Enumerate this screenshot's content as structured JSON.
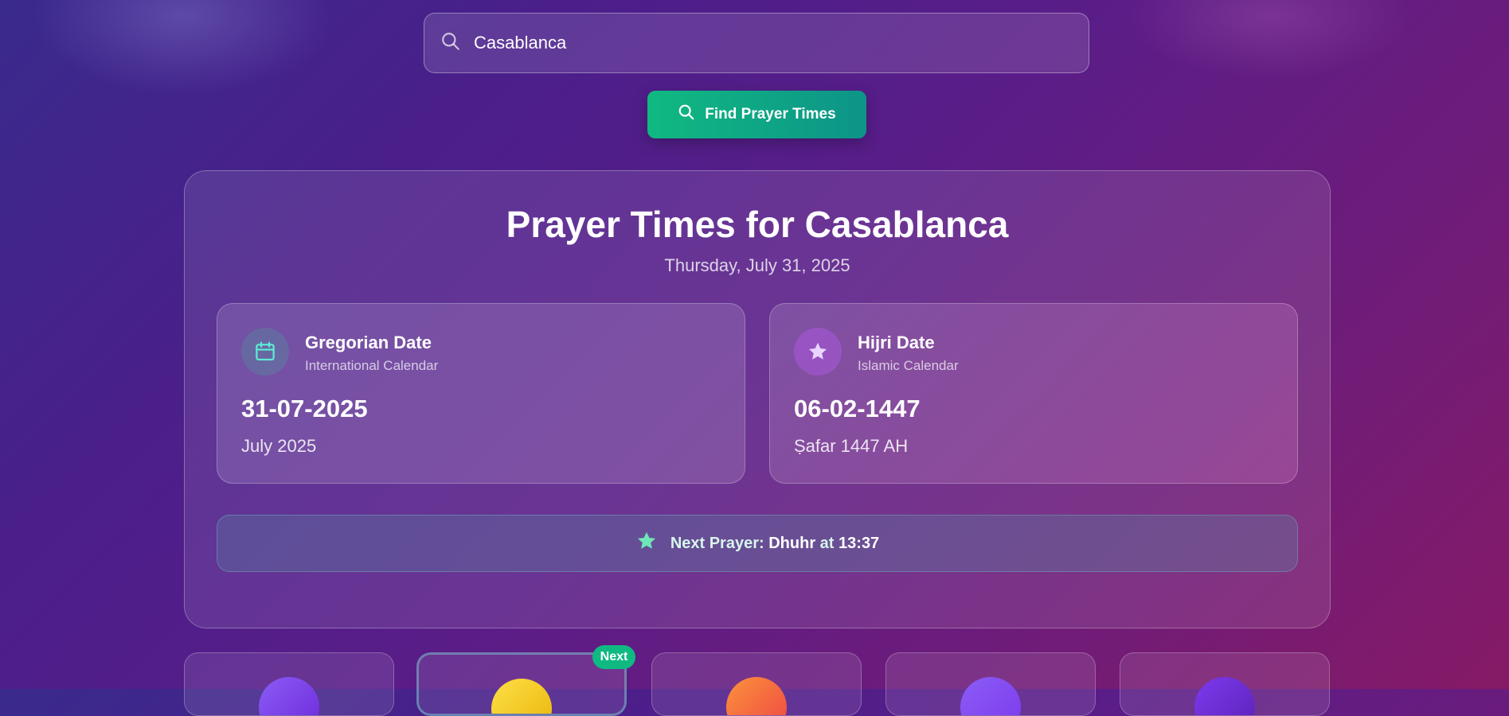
{
  "search": {
    "value": "Casablanca",
    "button_label": "Find Prayer Times"
  },
  "header": {
    "title": "Prayer Times for Casablanca",
    "subtitle": "Thursday, July 31, 2025"
  },
  "gregorian": {
    "title": "Gregorian Date",
    "subtitle": "International Calendar",
    "date": "31-07-2025",
    "month": "July 2025",
    "icon": "calendar-icon"
  },
  "hijri": {
    "title": "Hijri Date",
    "subtitle": "Islamic Calendar",
    "date": "06-02-1447",
    "month": "Ṣafar 1447 AH",
    "icon": "star-icon"
  },
  "next_prayer": {
    "prefix": "Next Prayer:",
    "name": "Dhuhr",
    "connector": "at",
    "time": "13:37"
  },
  "prayer_cards": {
    "badge": "Next",
    "colors": [
      "#7c4dff",
      "#f5c518",
      "#f26b3a",
      "#8a5cf6",
      "#6d3fd6"
    ]
  },
  "colors": {
    "accent": "#10b981",
    "background_start": "#3a2a8c",
    "background_end": "#861a66"
  }
}
